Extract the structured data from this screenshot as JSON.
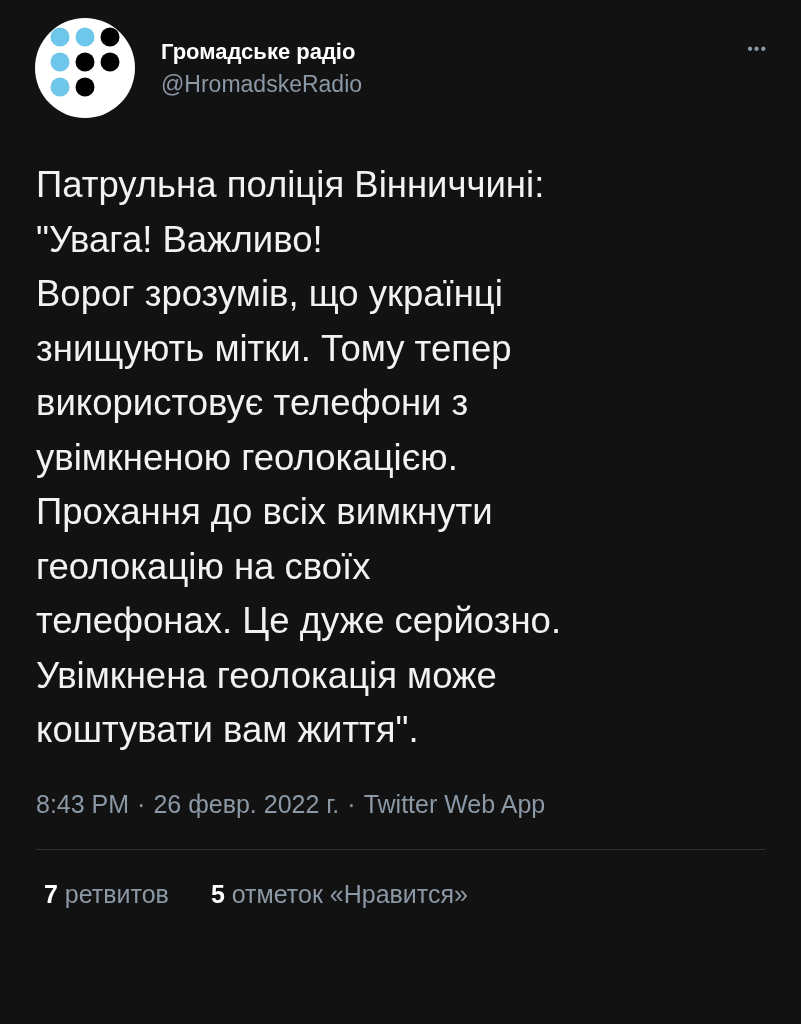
{
  "author": {
    "name": "Громадське радіо",
    "handle": "@HromadskeRadio"
  },
  "menu_icon": "•••",
  "text": "Патрульна поліція Вінниччині:\n\"Увага! Важливо!\nВорог зрозумів, що українці\nзнищують мітки. Тому тепер\nвикористовує телефони з\nувімкненою геолокацією.\nПрохання до всіх вимкнути\nгеолокацію на своїх\nтелефонах. Це дуже серйозно.\nУвімкнена геолокація може\nкоштувати вам життя\".",
  "meta": {
    "time": "8:43 PM",
    "date": "26 февр. 2022 г.",
    "source": "Twitter Web App",
    "separator": "·"
  },
  "stats": [
    {
      "count": "7",
      "label": "ретвитов"
    },
    {
      "count": "5",
      "label": "отметок «Нравится»"
    }
  ]
}
